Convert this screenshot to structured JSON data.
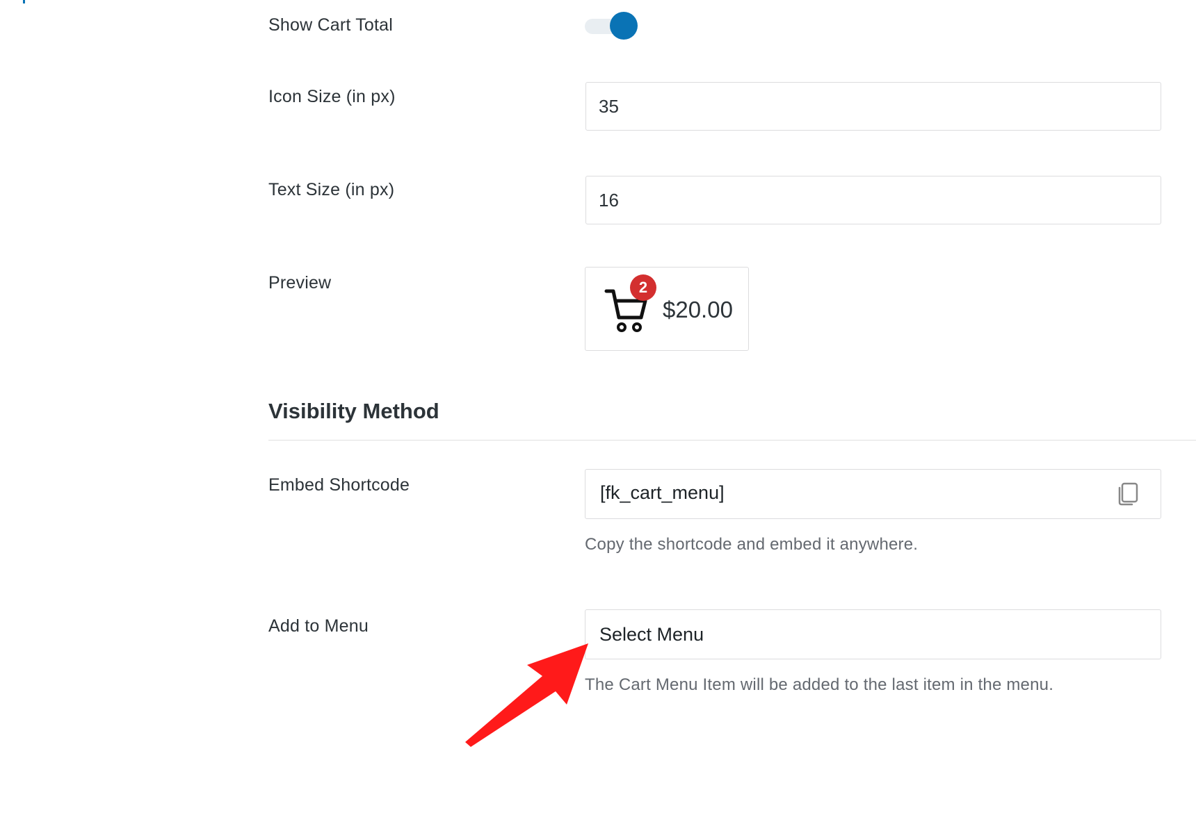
{
  "settings": {
    "show_cart_total": {
      "label": "Show Cart Total",
      "enabled": true
    },
    "icon_size": {
      "label": "Icon Size (in px)",
      "value": "35"
    },
    "text_size": {
      "label": "Text Size (in px)",
      "value": "16"
    },
    "preview": {
      "label": "Preview",
      "badge_count": "2",
      "price": "$20.00",
      "icon": "cart-icon"
    }
  },
  "visibility": {
    "title": "Visibility Method",
    "embed": {
      "label": "Embed Shortcode",
      "shortcode": "[fk_cart_menu]",
      "copy_icon": "copy-icon",
      "help": "Copy the shortcode and embed it anywhere."
    },
    "menu": {
      "label": "Add to Menu",
      "selected": "Select Menu",
      "help": "The Cart Menu Item will be added to the last item in the menu."
    }
  },
  "colors": {
    "accent": "#0a73b5",
    "badge": "#d32f2f",
    "annotation_arrow": "#ff1a1a"
  }
}
